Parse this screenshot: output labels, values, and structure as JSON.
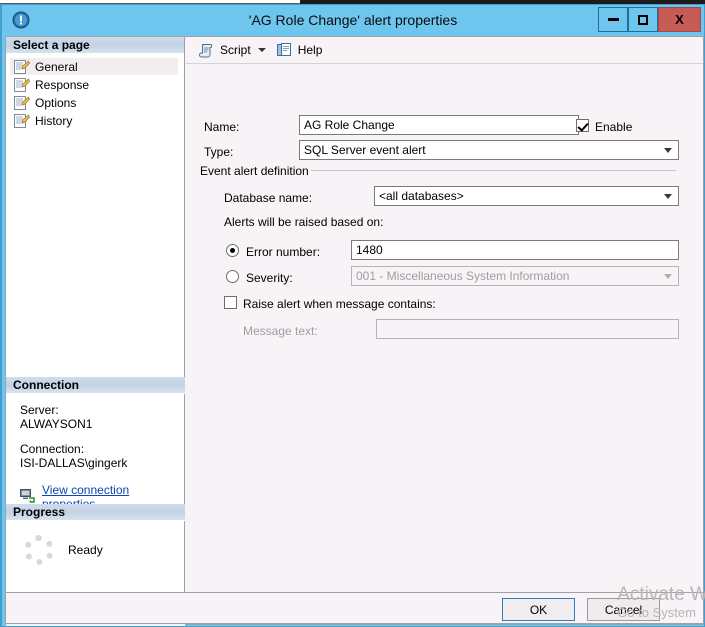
{
  "window": {
    "title": "'AG Role Change' alert properties",
    "icon": "alert-info-icon",
    "minimize_label": "Minimize",
    "maximize_label": "Maximize",
    "close_label": "X",
    "frame_color": "#6ec6ef",
    "close_color": "#c75b56"
  },
  "sidebar": {
    "select_page_header": "Select a page",
    "items": [
      {
        "label": "General",
        "icon": "page-script-icon",
        "selected": true
      },
      {
        "label": "Response",
        "icon": "page-script-icon",
        "selected": false
      },
      {
        "label": "Options",
        "icon": "page-script-icon",
        "selected": false
      },
      {
        "label": "History",
        "icon": "page-script-icon",
        "selected": false
      }
    ],
    "connection": {
      "header": "Connection",
      "server_label": "Server:",
      "server_value": "ALWAYSON1",
      "connection_label": "Connection:",
      "connection_value": "ISI-DALLAS\\gingerk",
      "link_text": "View connection properties",
      "link_icon": "server-connection-icon",
      "link_color": "#0b49b0"
    },
    "progress": {
      "header": "Progress",
      "status": "Ready",
      "spinner_icon": "progress-spinner-icon"
    }
  },
  "toolbar": {
    "script_label": "Script",
    "script_icon": "script-icon",
    "script_caret_icon": "chevron-down-icon",
    "help_label": "Help",
    "help_icon": "help-icon"
  },
  "form": {
    "name_label": "Name:",
    "name_value": "AG Role Change",
    "name_placeholder": "",
    "enable_label": "Enable",
    "enable_checked": true,
    "type_label": "Type:",
    "type_value": "SQL Server event alert",
    "group_label": "Event alert definition",
    "database_label": "Database name:",
    "database_value": "<all databases>",
    "raised_on_label": "Alerts will be raised based on:",
    "error_number_label": "Error number:",
    "error_number_selected": true,
    "error_number_value": "1480",
    "severity_label": "Severity:",
    "severity_selected": false,
    "severity_value": "001 - Miscellaneous System Information",
    "raise_alert_label": "Raise alert when message contains:",
    "raise_alert_checked": false,
    "message_text_label": "Message text:",
    "message_text_value": "",
    "message_text_placeholder": ""
  },
  "buttons": {
    "ok_label": "OK",
    "cancel_label": "Cancel"
  },
  "watermark": {
    "line1": "Activate W",
    "line2": "Go to System"
  }
}
